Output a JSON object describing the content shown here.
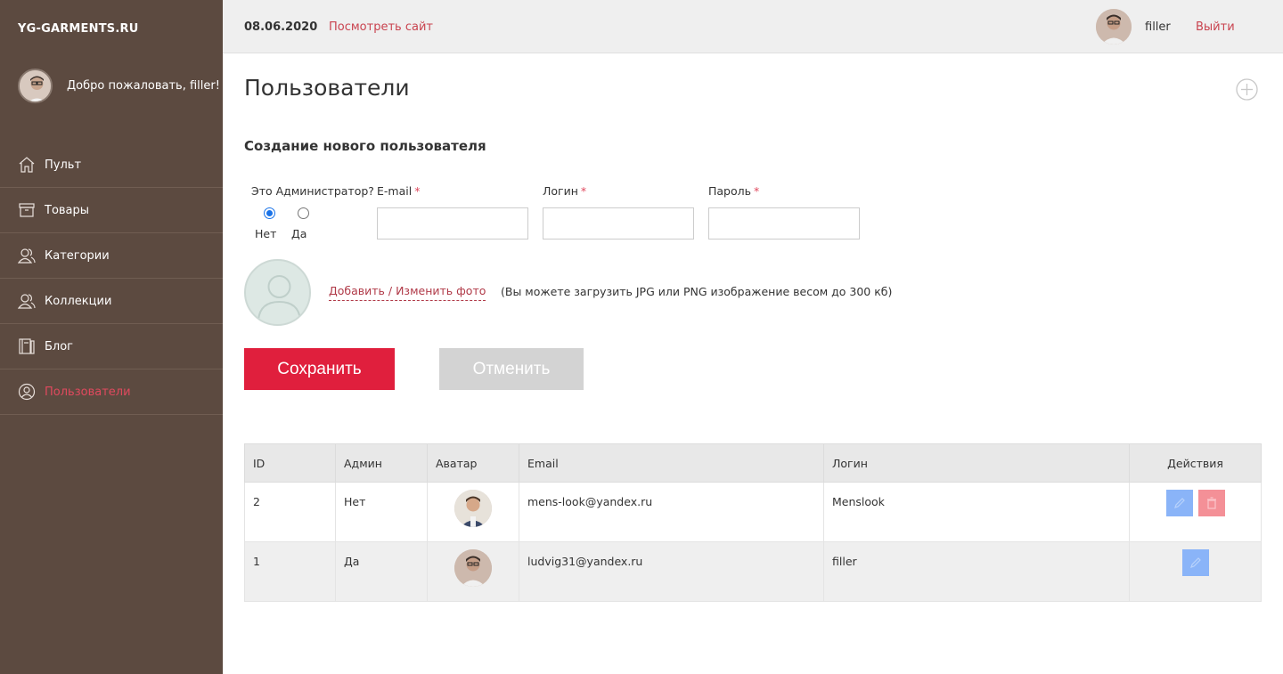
{
  "brand": "YG-GARMENTS.RU",
  "sidebar": {
    "welcome": "Добро пожаловать, filler!",
    "items": [
      {
        "label": "Пульт",
        "icon": "home-icon"
      },
      {
        "label": "Товары",
        "icon": "box-icon"
      },
      {
        "label": "Категории",
        "icon": "users-icon"
      },
      {
        "label": "Коллекции",
        "icon": "users-icon"
      },
      {
        "label": "Блог",
        "icon": "book-icon"
      },
      {
        "label": "Пользователи",
        "icon": "user-icon",
        "active": true
      }
    ]
  },
  "topbar": {
    "date": "08.06.2020",
    "site_link": "Посмотреть сайт",
    "user": "filler",
    "logout": "Выйти"
  },
  "main": {
    "title": "Пользователи",
    "form_title": "Создание нового пользователя",
    "admin_question": "Это Администратор?",
    "radio_no": "Нет",
    "radio_yes": "Да",
    "email_label": "E-mail",
    "login_label": "Логин",
    "password_label": "Пароль",
    "required_mark": "*",
    "photo_link": "Добавить / Изменить фото",
    "photo_hint": "(Вы можете загрузить JPG или PNG изображение весом до 300 кб)",
    "save": "Сохранить",
    "cancel": "Отменить"
  },
  "table": {
    "headers": [
      "ID",
      "Админ",
      "Аватар",
      "Email",
      "Логин",
      "Действия"
    ],
    "rows": [
      {
        "id": "2",
        "admin": "Нет",
        "email": "mens-look@yandex.ru",
        "login": "Menslook"
      },
      {
        "id": "1",
        "admin": "Да",
        "email": "ludvig31@yandex.ru",
        "login": "filler"
      }
    ]
  },
  "colors": {
    "sidebar_bg": "#5c4a40",
    "accent": "#e01f3d",
    "link": "#c9434f",
    "edit_button": "#8ab4f8",
    "delete_button": "#f49097"
  }
}
